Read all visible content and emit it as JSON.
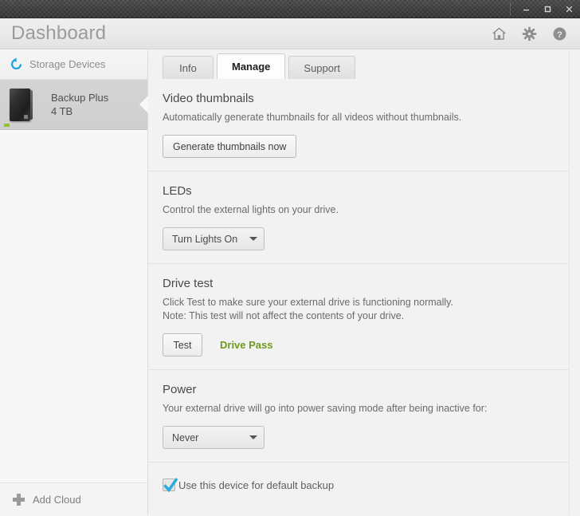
{
  "window": {
    "controls": {
      "minimize": "minimize",
      "maximize": "maximize",
      "close": "close"
    }
  },
  "header": {
    "title": "Dashboard",
    "icons": [
      {
        "name": "home-icon",
        "label": "Home"
      },
      {
        "name": "settings-gear-icon",
        "label": "Settings"
      },
      {
        "name": "help-icon",
        "label": "Help"
      }
    ]
  },
  "sidebar": {
    "section_label": "Storage Devices",
    "refresh_icon": "refresh-icon",
    "device": {
      "name": "Backup Plus",
      "capacity": "4 TB",
      "led_color": "#8fc21f"
    },
    "footer": {
      "add_cloud_label": "Add Cloud",
      "plus_icon": "plus-icon"
    }
  },
  "main": {
    "tabs": [
      {
        "label": "Info",
        "active": false
      },
      {
        "label": "Manage",
        "active": true
      },
      {
        "label": "Support",
        "active": false
      }
    ],
    "sections": {
      "video_thumbnails": {
        "title": "Video thumbnails",
        "description": "Automatically generate thumbnails for all videos without thumbnails.",
        "button_label": "Generate thumbnails now"
      },
      "leds": {
        "title": "LEDs",
        "description": "Control the external lights on your drive.",
        "dropdown_value": "Turn Lights On"
      },
      "drive_test": {
        "title": "Drive test",
        "description_line1": "Click Test to make sure your external drive is functioning normally.",
        "description_line2": "Note: This test will not affect the contents of your drive.",
        "button_label": "Test",
        "status": "Drive Pass",
        "status_color": "#6d9a1e"
      },
      "power": {
        "title": "Power",
        "description": "Your external drive will go into power saving mode after being inactive for:",
        "dropdown_value": "Never"
      },
      "default_backup": {
        "checkbox_label": "Use this device for default backup",
        "checked": true,
        "check_color": "#29abe2"
      }
    }
  }
}
